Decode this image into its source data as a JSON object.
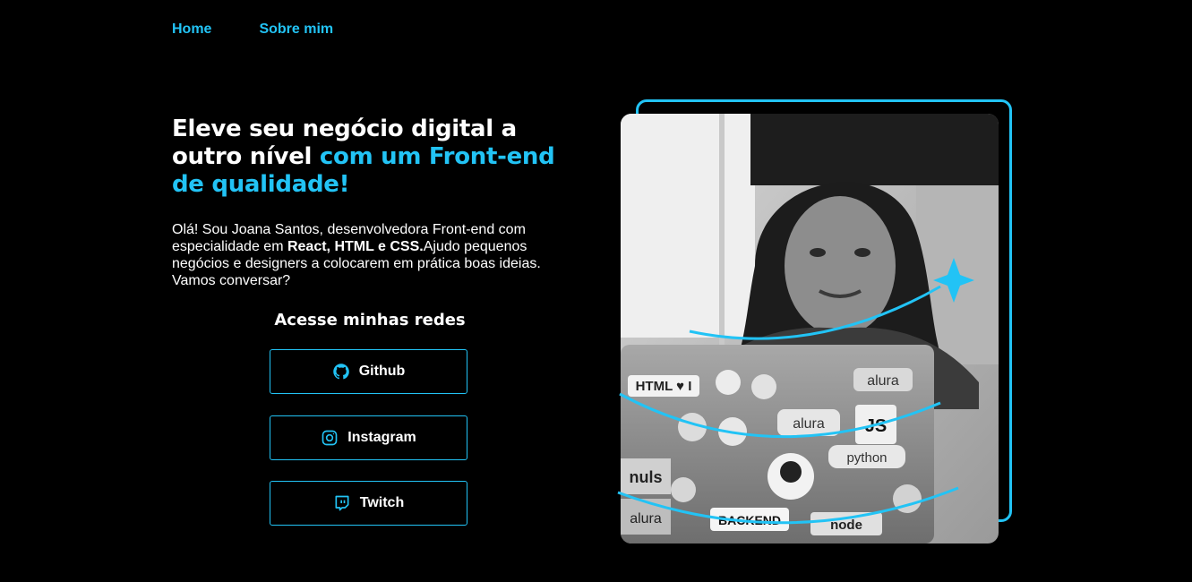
{
  "nav": {
    "items": [
      {
        "label": "Home"
      },
      {
        "label": "Sobre mim"
      }
    ]
  },
  "hero": {
    "title_part1": "Eleve seu negócio digital a outro nível ",
    "title_accent": "com um Front-end de qualidade!",
    "intro_part1": "Olá! Sou Joana Santos, desenvolvedora Front-end com especialidade em ",
    "intro_bold": "React, HTML e CSS.",
    "intro_part2": "Ajudo pequenos negócios e designers a colocarem em prática boas ideias. Vamos conversar?"
  },
  "social": {
    "title": "Acesse minhas redes",
    "links": [
      {
        "label": "Github",
        "icon": "github-icon"
      },
      {
        "label": "Instagram",
        "icon": "instagram-icon"
      },
      {
        "label": "Twitch",
        "icon": "twitch-icon"
      }
    ]
  },
  "profile_image": {
    "alt": "Foto de Joana Santos trabalhando no notebook",
    "laptop_stickers": [
      "HTML ♥ I",
      "alura",
      "alura",
      "JS",
      "python",
      "nuls",
      "alura",
      "BACKEND",
      "node"
    ]
  },
  "colors": {
    "accent": "#22c3f5",
    "background": "#000000",
    "text": "#ffffff"
  }
}
